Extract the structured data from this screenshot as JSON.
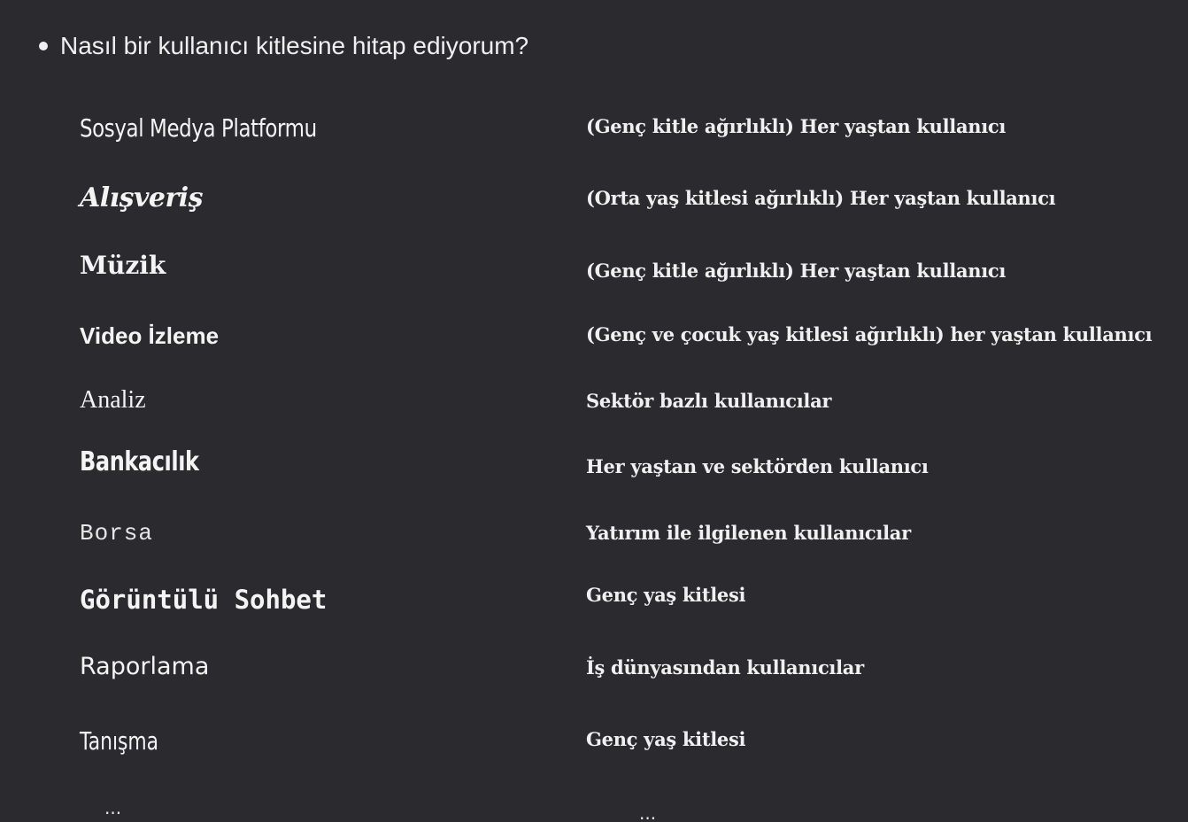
{
  "question": "Nasıl bir kullanıcı kitlesine hitap ediyorum?",
  "rows": [
    {
      "category": "Sosyal Medya Platformu",
      "audience": "(Genç kitle ağırlıklı) Her yaştan kullanıcı"
    },
    {
      "category": "Alışveriş",
      "audience": "(Orta yaş kitlesi ağırlıklı) Her yaştan kullanıcı"
    },
    {
      "category": "Müzik",
      "audience": "(Genç kitle ağırlıklı) Her yaştan kullanıcı"
    },
    {
      "category": "Video İzleme",
      "audience": "(Genç ve çocuk yaş kitlesi ağırlıklı) her yaştan kullanıcı"
    },
    {
      "category": "Analiz",
      "audience": "Sektör bazlı kullanıcılar"
    },
    {
      "category": "Bankacılık",
      "audience": "Her yaştan ve sektörden kullanıcı"
    },
    {
      "category": "Borsa",
      "audience": "Yatırım ile ilgilenen kullanıcılar"
    },
    {
      "category": "Görüntülü Sohbet",
      "audience": "Genç yaş kitlesi"
    },
    {
      "category": "Raporlama",
      "audience": "İş dünyasından kullanıcılar"
    },
    {
      "category": "Tanışma",
      "audience": "Genç yaş kitlesi"
    }
  ],
  "ellipsis_left": "...",
  "ellipsis_right": "..."
}
